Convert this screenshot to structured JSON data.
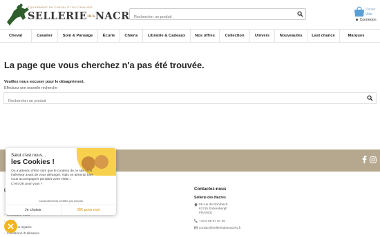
{
  "logo": {
    "tagline": "ÉQUIPEMENT DU CHEVAL ET DU CAVALIER",
    "name_left": "SELLERIE",
    "name_mid": "DES",
    "name_right": "NACRES"
  },
  "search_top": {
    "placeholder": "Rechercher un produit"
  },
  "cart": {
    "label": "Panier",
    "value": "Vide"
  },
  "account": {
    "label": "Connexion"
  },
  "nav": [
    "Cheval",
    "Cavalier",
    "Soin & Pansage",
    "Écurie",
    "Chiens",
    "Librairie & Cadeaux",
    "Nos offres",
    "Collection",
    "Univers",
    "Nouveautés",
    "Last chance",
    "Marques"
  ],
  "page": {
    "title": "La page que vous cherchez n'a pas été trouvée.",
    "apology": "Veuillez nous excuser pour le désagrément.",
    "hint": "Effectuez une nouvelle recherche",
    "search_placeholder": "Rechercher un produit"
  },
  "footer": {
    "contact_title": "Contactez-nous",
    "company": "Sellerie des Nacres",
    "address": [
      "55 rue de Rohrbach",
      "67415 Erckenbergh",
      "FRANCE"
    ],
    "phone": "+33 6 58 67 67 30",
    "email": "contact@selleriedesnacres.fr",
    "links_title": "L",
    "links": [
      "Contactez-nous",
      "...tion",
      "Mentions légales",
      "Conditions d'utilisation"
    ]
  },
  "cookie": {
    "greeting": "Salut c'est nous...",
    "title": "les Cookies !",
    "message": "On a attendu d'être sûrs que le contenu de ce site vous intéresse avant de vous déranger, mais on aimerait bien vous accompagner pendant votre visite...",
    "question": "C'est OK pour vous ?",
    "certified": "Consentements certifiés par axeptio",
    "decline": "Je choisis",
    "accept": "OK pour moi"
  },
  "colors": {
    "accent": "#b08a5a",
    "band": "#b5a88f",
    "cookie_yellow": "#f8d14c",
    "cart_blue": "#5a9fd4"
  }
}
